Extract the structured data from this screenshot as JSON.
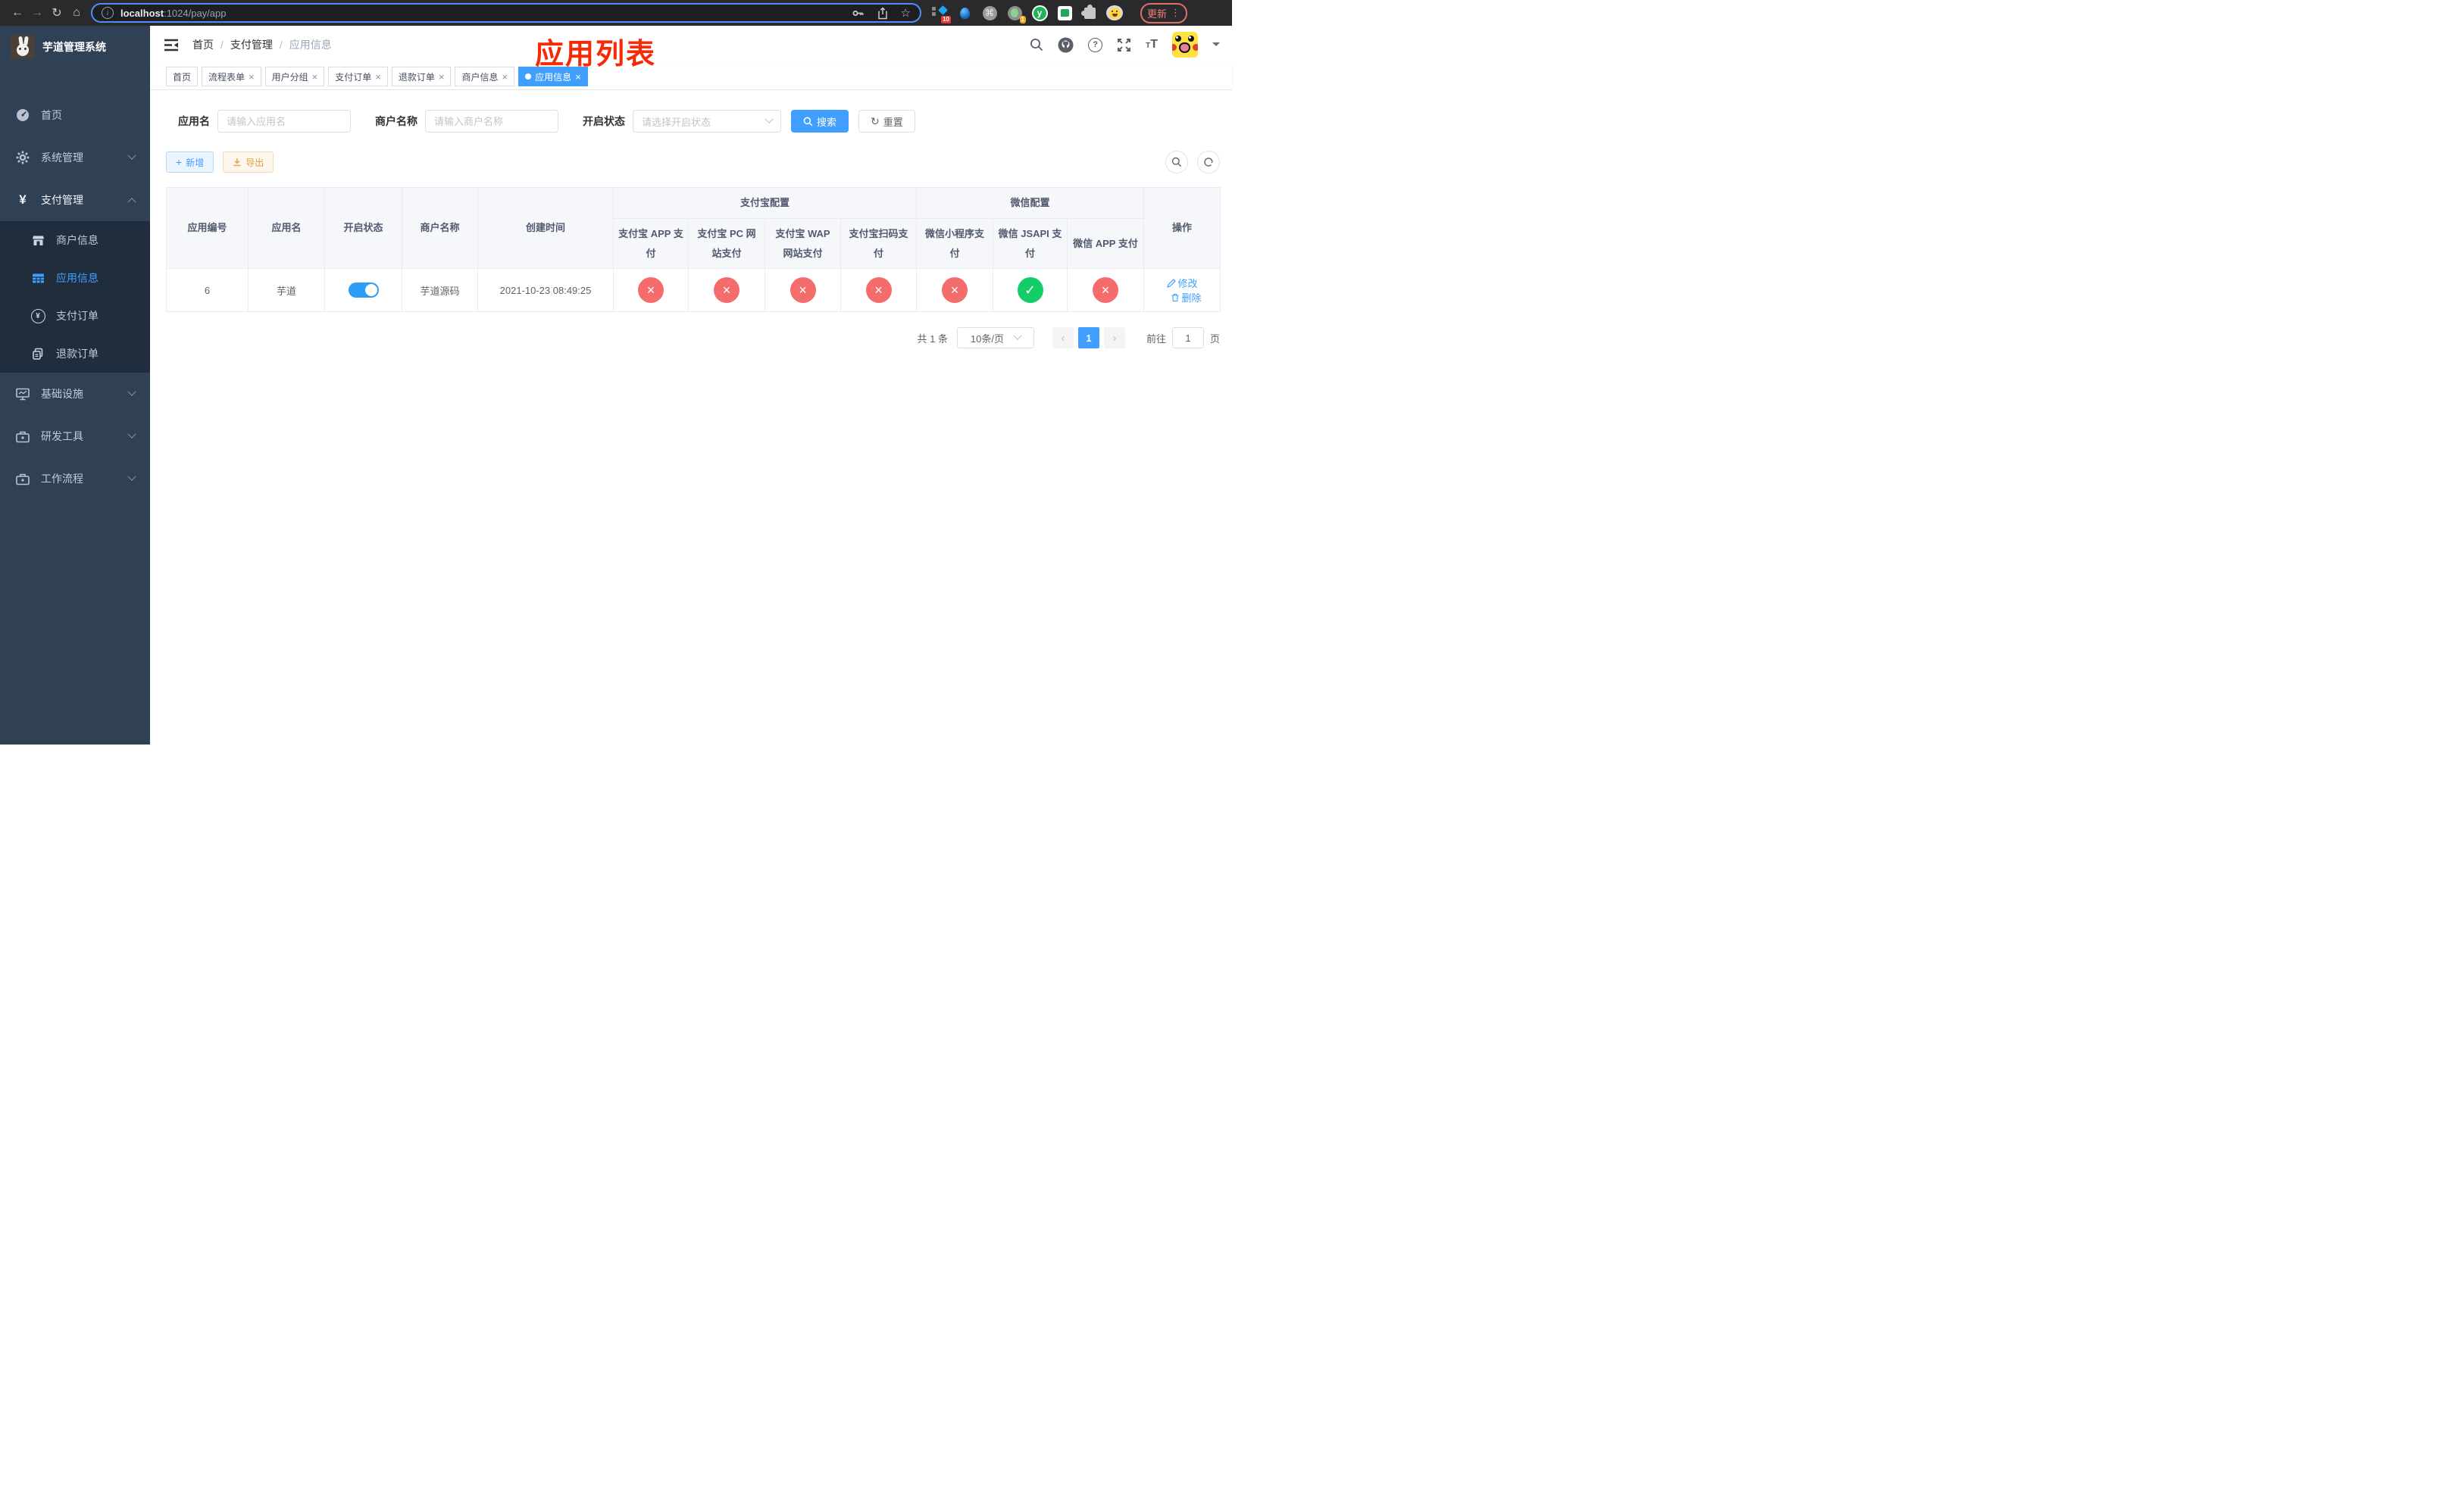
{
  "browser": {
    "url_host": "localhost",
    "url_path": ":1024/pay/app",
    "update_label": "更新",
    "ext_badge_10": "10",
    "ext_badge_1": "1",
    "ext_y_letter": "y"
  },
  "icons": {
    "back": "←",
    "forward": "→",
    "reload": "↻",
    "home": "⌂",
    "star": "☆",
    "info": "i",
    "command": "⌘",
    "kebab": "⋮",
    "help": "?",
    "t_small": "T",
    "t_large": "T",
    "close_x": "×",
    "check": "✓",
    "plus": "+",
    "yen": "¥",
    "prev": "‹",
    "next": "›",
    "reset": "↻"
  },
  "sidebar": {
    "logo_title": "芋道管理系统",
    "items": [
      {
        "label": "首页"
      },
      {
        "label": "系统管理"
      },
      {
        "label": "支付管理"
      },
      {
        "label": "基础设施"
      },
      {
        "label": "研发工具"
      },
      {
        "label": "工作流程"
      }
    ],
    "submenu": [
      {
        "label": "商户信息"
      },
      {
        "label": "应用信息"
      },
      {
        "label": "支付订单"
      },
      {
        "label": "退款订单"
      }
    ]
  },
  "navbar": {
    "breadcrumb": [
      "首页",
      "支付管理",
      "应用信息"
    ]
  },
  "annotation": {
    "title": "应用列表",
    "color": "#f72a08"
  },
  "tabs": [
    {
      "label": "首页"
    },
    {
      "label": "流程表单"
    },
    {
      "label": "用户分组"
    },
    {
      "label": "支付订单"
    },
    {
      "label": "退款订单"
    },
    {
      "label": "商户信息"
    },
    {
      "label": "应用信息"
    }
  ],
  "filter": {
    "app_name_label": "应用名",
    "app_name_placeholder": "请输入应用名",
    "merchant_label": "商户名称",
    "merchant_placeholder": "请输入商户名称",
    "status_label": "开启状态",
    "status_placeholder": "请选择开启状态",
    "search_label": "搜索",
    "reset_label": "重置"
  },
  "toolbar": {
    "add_label": "新增",
    "export_label": "导出"
  },
  "table": {
    "headers": {
      "app_id": "应用编号",
      "app_name": "应用名",
      "open_status": "开启状态",
      "merchant_name": "商户名称",
      "create_time": "创建时间",
      "alipay_group": "支付宝配置",
      "wechat_group": "微信配置",
      "actions": "操作",
      "sub": [
        "支付宝 APP 支付",
        "支付宝 PC 网站支付",
        "支付宝 WAP 网站支付",
        "支付宝扫码支付",
        "微信小程序支付",
        "微信 JSAPI 支付",
        "微信 APP 支付"
      ]
    },
    "row": {
      "app_id": "6",
      "app_name": "芋道",
      "open_status_on": true,
      "merchant_name": "芋道源码",
      "create_time": "2021-10-23 08:49:25",
      "statuses": [
        "x",
        "x",
        "x",
        "x",
        "x",
        "check",
        "x"
      ],
      "edit_label": "修改",
      "delete_label": "删除"
    }
  },
  "pagination": {
    "total": "共 1 条",
    "page_size": "10条/页",
    "current_page": "1",
    "goto_label": "前往",
    "goto_value": "1",
    "page_unit": "页"
  },
  "colors": {
    "primary": "#409eff",
    "danger": "#f56c6c",
    "success": "#13ce66",
    "annotation": "#f72a08"
  }
}
